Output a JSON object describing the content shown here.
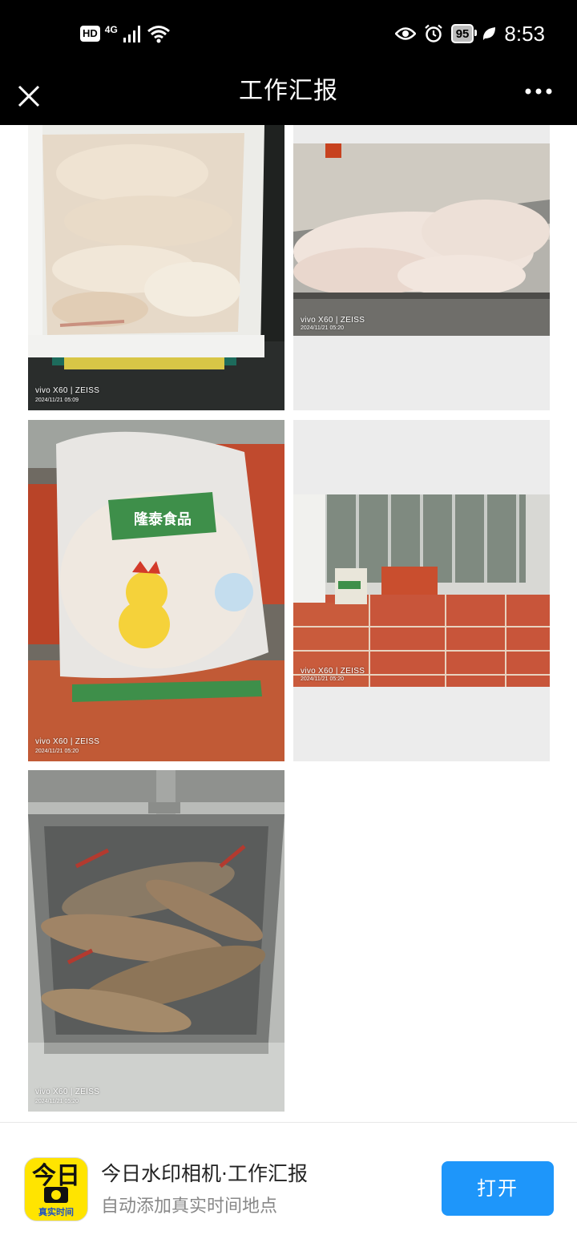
{
  "status_bar": {
    "hd": "HD",
    "network": "4G",
    "battery": "95",
    "time": "8:53",
    "icons": [
      "signal-icon",
      "wifi-icon",
      "eye-icon",
      "alarm-icon",
      "battery-icon",
      "leaf-icon"
    ]
  },
  "header": {
    "title": "工作汇报",
    "close_icon": "close-icon",
    "more_icon": "more-dots-icon"
  },
  "photos": [
    {
      "subject": "frozen chicken in white crate",
      "watermark_brand": "vivo X60 | ZEISS",
      "watermark_time": "2024/11/21 05:09"
    },
    {
      "subject": "raw chickens on steel counter",
      "watermark_brand": "vivo X60 | ZEISS",
      "watermark_time": "2024/11/21 05:20"
    },
    {
      "subject": "bagged chicken with cartoon logo",
      "watermark_brand": "vivo X60 | ZEISS",
      "watermark_time": "2024/11/21 05:20",
      "bag_brand": "隆泰食品"
    },
    {
      "subject": "stacked cardboard boxes by window",
      "watermark_brand": "vivo X60 | ZEISS",
      "watermark_time": "2024/11/21 05:20"
    },
    {
      "subject": "fish in steel sink",
      "watermark_brand": "vivo X60 | ZEISS",
      "watermark_time": "2024/11/21 05:20"
    }
  ],
  "banner": {
    "app_icon_text": "真实时间",
    "app_icon_glyph": "今日",
    "title": "今日水印相机·工作汇报",
    "subtitle": "自动添加真实时间地点",
    "open_label": "打开"
  },
  "colors": {
    "header_bg": "#000000",
    "open_button": "#1e96fa",
    "app_icon_bg": "#ffe400"
  }
}
